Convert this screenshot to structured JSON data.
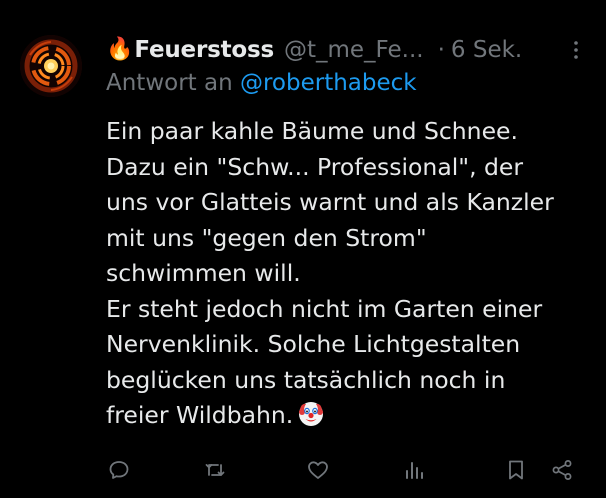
{
  "tweet": {
    "name_emoji": "🔥",
    "display_name": "Feuerstoss",
    "handle": "@t_me_Fe...",
    "dot": "·",
    "time": "6 Sek.",
    "reply_prefix": "Antwort an ",
    "reply_mention": "@roberthabeck",
    "body_lines": [
      "Ein paar kahle Bäume und Schnee.",
      "Dazu ein \"Schw... Professional\", der",
      "uns vor Glatteis warnt und als Kanzler",
      "mit uns \"gegen den Strom\"",
      "schwimmen will.",
      "Er steht jedoch nicht im Garten einer",
      "Nervenklinik. Solche Lichtgestalten",
      "beglücken uns tatsächlich noch in",
      "freier Wildbahn."
    ]
  },
  "icons": {
    "more": "more-vertical-icon",
    "reply": "reply-icon",
    "retweet": "retweet-icon",
    "like": "heart-icon",
    "views": "views-icon",
    "bookmark": "bookmark-icon",
    "share": "share-icon",
    "emoji": "clown-face-emoji"
  },
  "colors": {
    "background": "#000000",
    "text": "#e7e9ea",
    "muted": "#71767b",
    "link": "#1d9bf0"
  }
}
